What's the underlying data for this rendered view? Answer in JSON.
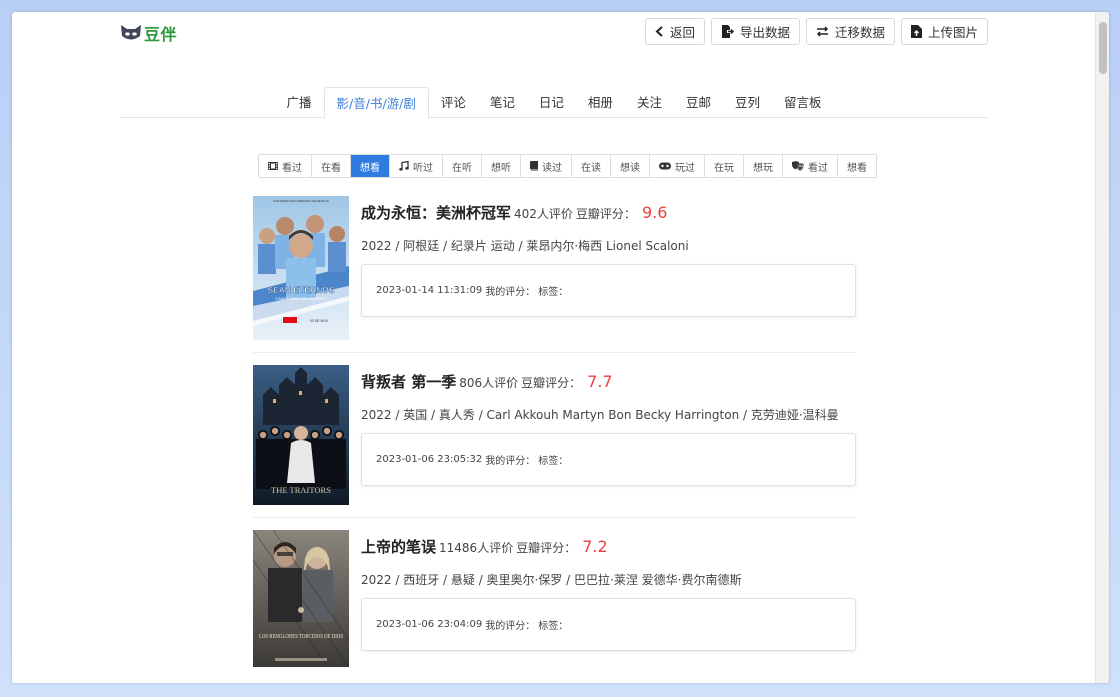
{
  "app": {
    "logo_text": "豆伴"
  },
  "top_buttons": [
    {
      "label": "返回",
      "icon": "chevron-left-icon"
    },
    {
      "label": "导出数据",
      "icon": "file-export-icon"
    },
    {
      "label": "迁移数据",
      "icon": "exchange-icon"
    },
    {
      "label": "上传图片",
      "icon": "file-upload-icon"
    }
  ],
  "tabs": [
    {
      "label": "广播"
    },
    {
      "label": "影/音/书/游/剧",
      "active": true
    },
    {
      "label": "评论"
    },
    {
      "label": "笔记"
    },
    {
      "label": "日记"
    },
    {
      "label": "相册"
    },
    {
      "label": "关注"
    },
    {
      "label": "豆邮"
    },
    {
      "label": "豆列"
    },
    {
      "label": "留言板"
    }
  ],
  "filters": [
    {
      "label": "看过",
      "icon": "film-icon"
    },
    {
      "label": "在看"
    },
    {
      "label": "想看",
      "active": true
    },
    {
      "label": "听过",
      "icon": "music-icon"
    },
    {
      "label": "在听"
    },
    {
      "label": "想听"
    },
    {
      "label": "读过",
      "icon": "book-icon"
    },
    {
      "label": "在读"
    },
    {
      "label": "想读"
    },
    {
      "label": "玩过",
      "icon": "gamepad-icon"
    },
    {
      "label": "在玩"
    },
    {
      "label": "想玩"
    },
    {
      "label": "看过",
      "icon": "theater-masks-icon"
    },
    {
      "label": "想看"
    }
  ],
  "items": [
    {
      "title": "成为永恒：美洲杯冠军",
      "rating_count": "402人评价",
      "score_label": "豆瓣评分：",
      "score": "9.6",
      "meta": "2022 / 阿根廷 / 纪录片 运动 / 莱昂内尔·梅西 Lionel Scaloni",
      "date": "2023-01-14 11:31:09",
      "my_rating_label": "我的评分：",
      "tags_label": "标签：",
      "poster": {
        "top_text": "UNA SERIE DOCUMENTAL DE NETFLIX",
        "big_text": "SEAN ETERNOS",
        "sub_text": "CAMPEONES DE AMÉRICA",
        "date_text": "03 DE NOV"
      }
    },
    {
      "title": "背叛者 第一季",
      "rating_count": "806人评价",
      "score_label": "豆瓣评分：",
      "score": "7.7",
      "meta": "2022 / 英国 / 真人秀 / Carl Akkouh Martyn Bon Becky Harrington / 克劳迪娅·温科曼",
      "date": "2023-01-06 23:05:32",
      "my_rating_label": "我的评分：",
      "tags_label": "标签：",
      "poster": {
        "big_text": "THE TRAITORS"
      }
    },
    {
      "title": "上帝的笔误",
      "rating_count": "11486人评价",
      "score_label": "豆瓣评分：",
      "score": "7.2",
      "meta": "2022 / 西班牙 / 悬疑 / 奥里奥尔·保罗 / 巴巴拉·莱涅 爱德华·费尔南德斯",
      "date": "2023-01-06 23:04:09",
      "my_rating_label": "我的评分：",
      "tags_label": "标签：",
      "poster": {
        "big_text": "LOS RENGLONES TORCIDOS DE DIOS"
      }
    }
  ],
  "colors": {
    "accent": "#2e7ce0",
    "score": "#e8423c",
    "logo": "#2e963d"
  }
}
